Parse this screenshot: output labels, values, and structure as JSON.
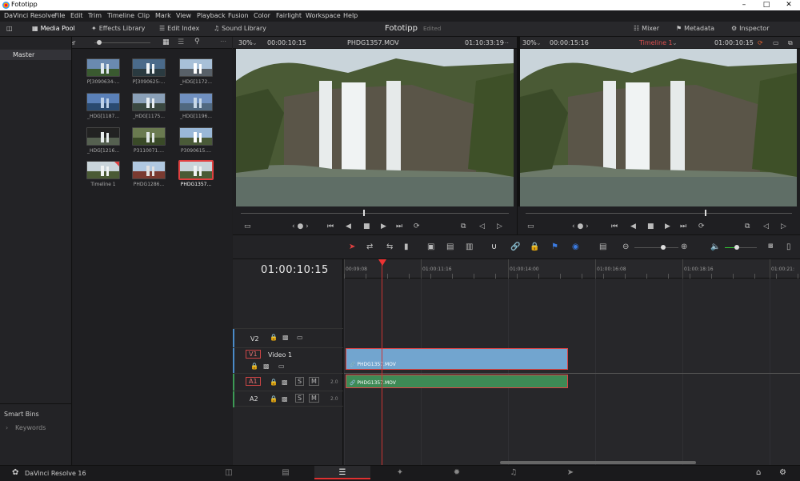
{
  "window": {
    "title": "Fototipp"
  },
  "menu": [
    "DaVinci Resolve",
    "File",
    "Edit",
    "Trim",
    "Timeline",
    "Clip",
    "Mark",
    "View",
    "Playback",
    "Fusion",
    "Color",
    "Fairlight",
    "Workspace",
    "Help"
  ],
  "toolbar": {
    "media_pool": "Media Pool",
    "effects_library": "Effects Library",
    "edit_index": "Edit Index",
    "sound_library": "Sound Library",
    "project_title": "Fototipp",
    "project_status": "Edited",
    "mixer": "Mixer",
    "metadata": "Metadata",
    "inspector": "Inspector"
  },
  "media_pool": {
    "bin": "Master",
    "bin_list_item": "Master",
    "clips": [
      {
        "label": "P[3090634-..."
      },
      {
        "label": "P[3090625-..."
      },
      {
        "label": "_HDG[1172..."
      },
      {
        "label": "_HDG[1187..."
      },
      {
        "label": "_HDG[1175..."
      },
      {
        "label": "_HDG[1196..."
      },
      {
        "label": "_HDG[1216..."
      },
      {
        "label": "P3110071...."
      },
      {
        "label": "P3090615...."
      },
      {
        "label": "Timeline 1"
      },
      {
        "label": "PHDG1286..."
      },
      {
        "label": "PHDG1357..."
      }
    ],
    "smart_bins": "Smart Bins",
    "keywords": "Keywords"
  },
  "source_viewer": {
    "zoom": "30%",
    "timecode_in": "00:00:10:15",
    "clip_name": "PHDG1357.MOV",
    "timecode": "01:10:33:19"
  },
  "timeline_viewer": {
    "zoom": "30%",
    "timecode_in": "00:00:15:16",
    "timeline_name": "Timeline 1",
    "timecode": "01:00:10:15"
  },
  "timeline": {
    "timecode": "01:00:10:15",
    "ruler": [
      "00:09:08",
      "01:00:11:16",
      "01:00:14:00",
      "01:00:16:08",
      "01:00:18:16",
      "01:00:21:"
    ],
    "tracks": {
      "v2": {
        "name": "V2"
      },
      "v1": {
        "name": "V1",
        "title": "Video 1"
      },
      "a1": {
        "name": "A1",
        "level": "2.0",
        "solo": "S",
        "mute": "M"
      },
      "a2": {
        "name": "A2",
        "level": "2.0",
        "solo": "S",
        "mute": "M"
      }
    },
    "video_clip": "PHDG1357.MOV",
    "audio_clip": "PHDG1357.MOV"
  },
  "pages": {
    "app_name": "DaVinci Resolve 16"
  }
}
